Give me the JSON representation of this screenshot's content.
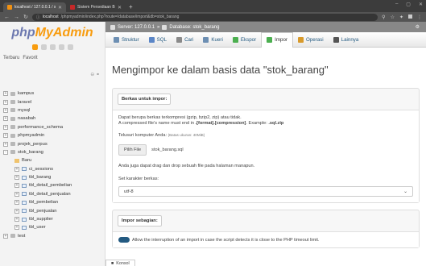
{
  "browser": {
    "tabs": [
      {
        "label": "localhost / 127.0.0.1 / stok_baran",
        "active": true
      },
      {
        "label": "Sistem Persediaan Barang",
        "active": false
      }
    ],
    "url_host": "localhost",
    "url_path": "/phpmyadmin/index.php?route=/database/import&db=stok_barang"
  },
  "sidebar": {
    "logo_php": "php",
    "logo_myadmin": "MyAdmin",
    "recent_label": "Terbaru",
    "favorites_label": "Favorit",
    "tree": [
      {
        "label": "kampus",
        "kind": "db",
        "toggle": "+"
      },
      {
        "label": "laravel",
        "kind": "db",
        "toggle": "+"
      },
      {
        "label": "mysql",
        "kind": "db",
        "toggle": "+"
      },
      {
        "label": "nasabah",
        "kind": "db",
        "toggle": "+"
      },
      {
        "label": "performance_schema",
        "kind": "db",
        "toggle": "+"
      },
      {
        "label": "phpmyadmin",
        "kind": "db",
        "toggle": "+"
      },
      {
        "label": "projek_perpus",
        "kind": "db",
        "toggle": "+"
      },
      {
        "label": "stok_barang",
        "kind": "db",
        "toggle": "-"
      },
      {
        "label": "Baru",
        "kind": "new",
        "toggle": ""
      },
      {
        "label": "ci_sessions",
        "kind": "table",
        "toggle": "+"
      },
      {
        "label": "tbl_barang",
        "kind": "table",
        "toggle": "+"
      },
      {
        "label": "tbl_detail_pembelian",
        "kind": "table",
        "toggle": "+"
      },
      {
        "label": "tbl_detail_penjualan",
        "kind": "table",
        "toggle": "+"
      },
      {
        "label": "tbl_pembelian",
        "kind": "table",
        "toggle": "+"
      },
      {
        "label": "tbl_penjualan",
        "kind": "table",
        "toggle": "+"
      },
      {
        "label": "tbl_supplier",
        "kind": "table",
        "toggle": "+"
      },
      {
        "label": "tbl_user",
        "kind": "table",
        "toggle": "+"
      },
      {
        "label": "test",
        "kind": "db",
        "toggle": "+"
      }
    ]
  },
  "breadcrumb": {
    "server": "Server: 127.0.0.1",
    "database": "Database: stok_barang"
  },
  "menu": [
    {
      "label": "Struktur",
      "icon": "structure-icon",
      "color": "#6d8fb3"
    },
    {
      "label": "SQL",
      "icon": "sql-icon",
      "color": "#5b86c7"
    },
    {
      "label": "Cari",
      "icon": "search-icon",
      "color": "#8a8a8a"
    },
    {
      "label": "Kueri",
      "icon": "query-icon",
      "color": "#6d8fb3"
    },
    {
      "label": "Ekspor",
      "icon": "export-icon",
      "color": "#4caf50"
    },
    {
      "label": "Impor",
      "icon": "import-icon",
      "color": "#4caf50"
    },
    {
      "label": "Operasi",
      "icon": "wrench-icon",
      "color": "#d89a2b"
    },
    {
      "label": "Lainnya",
      "icon": "chevron-down-icon",
      "color": "#555"
    }
  ],
  "page": {
    "title": "Mengimpor ke dalam basis data \"stok_barang\"",
    "file_section": {
      "legend": "Berkas untuk impor:",
      "compress_line1": "Dapat berupa berkas terkompresi (gzip, bzip2, zip) atau tidak.",
      "compress_line2_a": "A compressed file's name must end in ",
      "compress_line2_b": ".[format].[compression]",
      "compress_line2_c": ". Example: ",
      "compress_line2_d": ".sql.zip",
      "browse_label": "Telusuri komputer Anda:",
      "max_size": "(Batas ukuran: 40MiB)",
      "choose_file": "Pilih File",
      "file_name": "stok_barang.sql",
      "drag_drop": "Anda juga dapat drag dan drop sebuah file pada halaman manapun.",
      "charset_label": "Set karakter berkas:",
      "charset_value": "utf-8"
    },
    "partial_section": {
      "legend": "Impor sebagian:",
      "interrupt_text": "Allow the interruption of an import in case the script detects it is close to the PHP timeout limit."
    },
    "console_label": "Konsol"
  }
}
